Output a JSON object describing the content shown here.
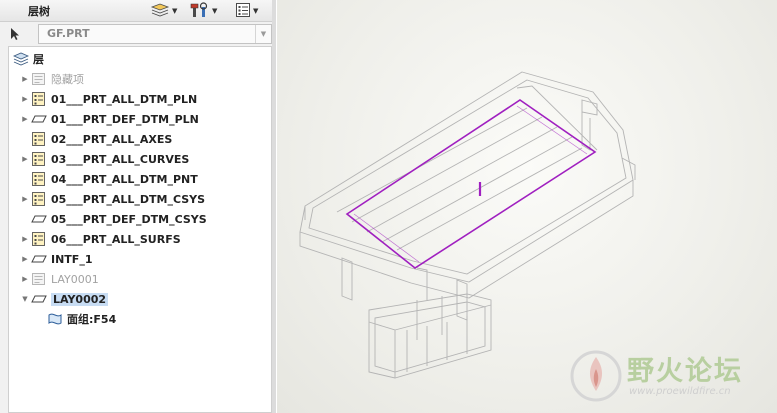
{
  "panel": {
    "title": "层树",
    "model_selector": {
      "value": "GF.PRT"
    }
  },
  "toolbar": {
    "items": [
      {
        "icon": "layers-display-icon"
      },
      {
        "icon": "tools-icon"
      },
      {
        "icon": "list-settings-icon"
      }
    ]
  },
  "tree": {
    "root": {
      "label": "层",
      "icon": "layers-icon"
    },
    "items": [
      {
        "label": "隐藏项",
        "icon": "hidden-layer-icon",
        "expandable": true,
        "style": "grey"
      },
      {
        "label": "01___PRT_ALL_DTM_PLN",
        "icon": "layer-list-icon",
        "expandable": true
      },
      {
        "label": "01___PRT_DEF_DTM_PLN",
        "icon": "plane-layer-icon",
        "expandable": true
      },
      {
        "label": "02___PRT_ALL_AXES",
        "icon": "layer-list-icon",
        "expandable": false
      },
      {
        "label": "03___PRT_ALL_CURVES",
        "icon": "layer-list-icon",
        "expandable": true
      },
      {
        "label": "04___PRT_ALL_DTM_PNT",
        "icon": "layer-list-icon",
        "expandable": false
      },
      {
        "label": "05___PRT_ALL_DTM_CSYS",
        "icon": "layer-list-icon",
        "expandable": true
      },
      {
        "label": "05___PRT_DEF_DTM_CSYS",
        "icon": "plane-layer-icon",
        "expandable": false
      },
      {
        "label": "06___PRT_ALL_SURFS",
        "icon": "layer-list-icon",
        "expandable": true
      },
      {
        "label": "INTF_1",
        "icon": "plane-layer-icon",
        "expandable": true
      },
      {
        "label": "LAY0001",
        "icon": "hidden-layer-icon",
        "expandable": true,
        "style": "grey"
      },
      {
        "label": "LAY0002",
        "icon": "plane-layer-icon",
        "expandable": true,
        "expanded": true,
        "selected": true
      },
      {
        "label": "面组:F54",
        "icon": "quilt-icon",
        "expandable": false,
        "child": true
      }
    ]
  },
  "watermark": {
    "text": "野火论坛",
    "url": "www.proewildfire.cn"
  },
  "colors": {
    "accent_purple": "#a020c0",
    "selection_bg": "#c7dcf3",
    "wireframe": "#b4b4b4"
  }
}
